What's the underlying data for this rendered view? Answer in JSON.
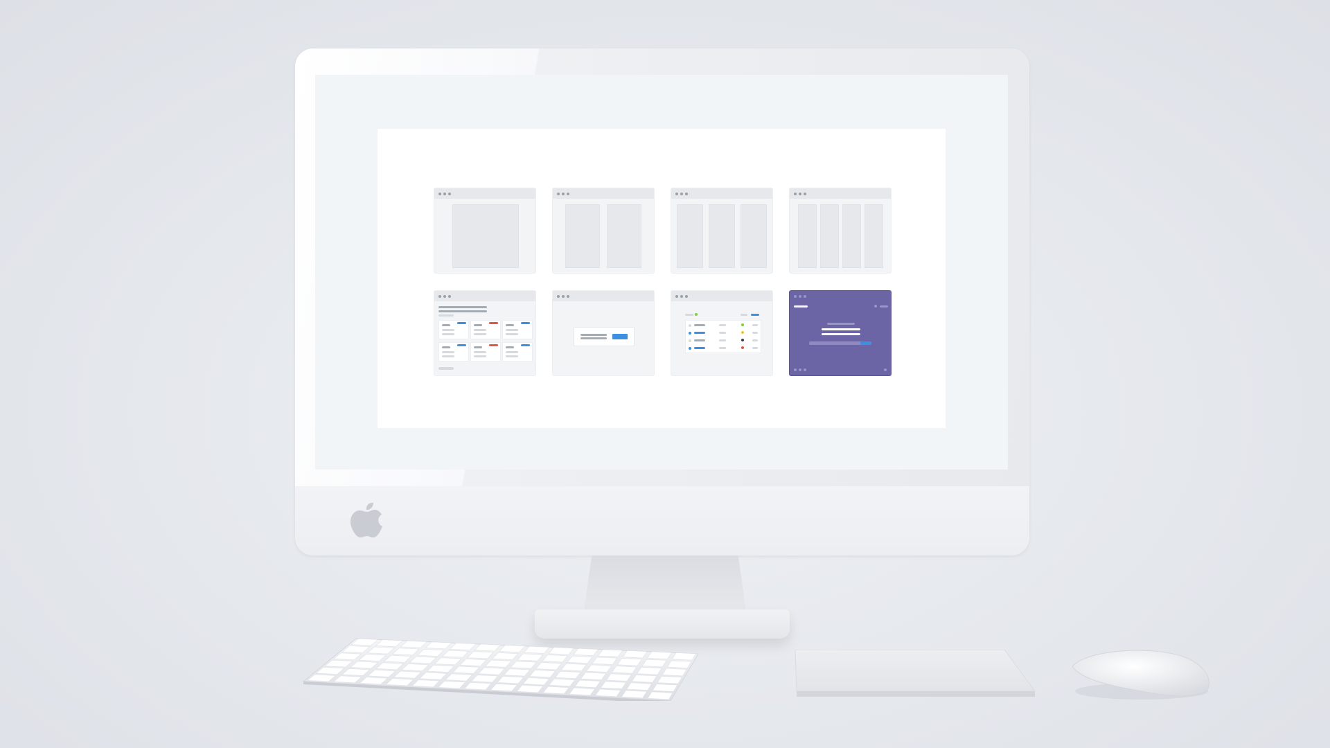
{
  "scene": {
    "background_color": "#e6e9ed",
    "device": "imac",
    "logo_icon": "apple-logo-icon"
  },
  "screen": {
    "background_color": "#f2f5f8",
    "canvas_color": "#ffffff",
    "thumbnails": [
      {
        "name": "layout-one-panel",
        "panels": 1
      },
      {
        "name": "layout-two-panels",
        "panels": 2
      },
      {
        "name": "layout-three-panels",
        "panels": 3
      },
      {
        "name": "layout-four-panels",
        "panels": 4
      },
      {
        "name": "layout-card-grid",
        "variant": "cards"
      },
      {
        "name": "layout-dialog",
        "variant": "dialog"
      },
      {
        "name": "layout-status-list",
        "variant": "list"
      },
      {
        "name": "layout-purple-splash",
        "variant": "splash",
        "accent": "#6b65a6"
      }
    ],
    "colors": {
      "accent_blue": "#3d8fe0",
      "accent_red": "#e3583d",
      "accent_green": "#7bcf3a",
      "accent_yellow": "#f3c623",
      "panel_grey": "#e6e8eb",
      "purple": "#6b65a6"
    }
  },
  "peripherals": {
    "keyboard": "keyboard-icon",
    "trackpad": "trackpad-icon",
    "mouse": "mouse-icon"
  }
}
